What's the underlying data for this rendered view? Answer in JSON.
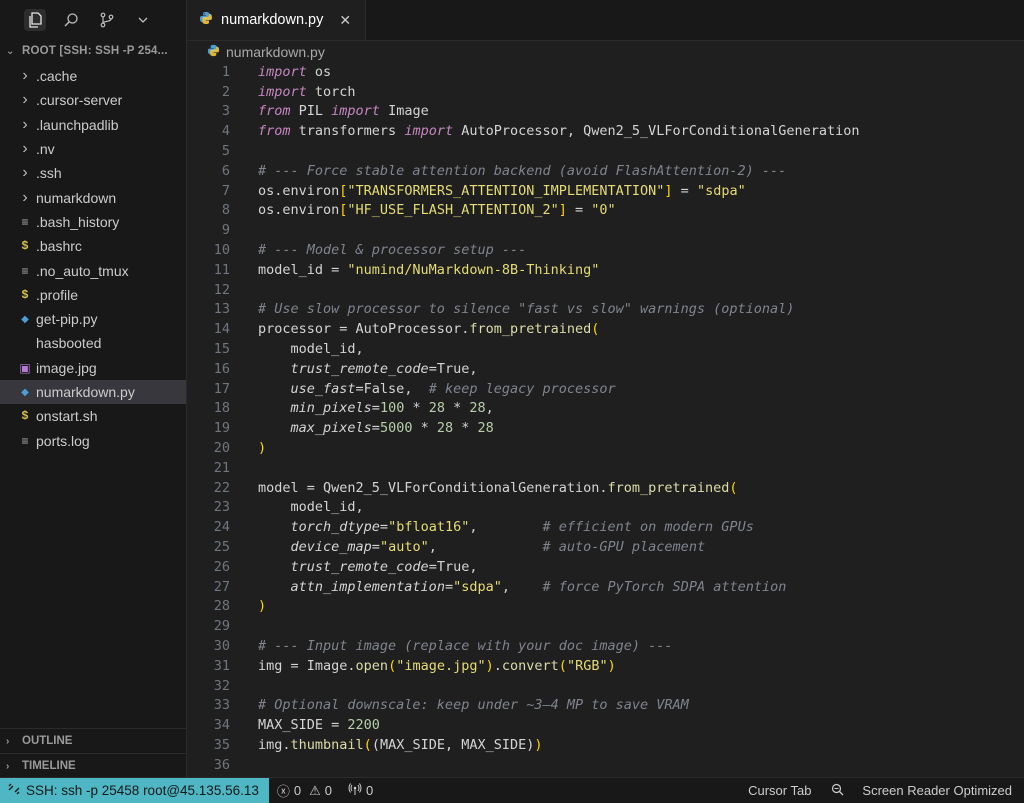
{
  "sidebar": {
    "root_label": "ROOT [SSH: SSH -P 254...",
    "items": [
      {
        "label": ".cache",
        "kind": "folder"
      },
      {
        "label": ".cursor-server",
        "kind": "folder"
      },
      {
        "label": ".launchpadlib",
        "kind": "folder"
      },
      {
        "label": ".nv",
        "kind": "folder"
      },
      {
        "label": ".ssh",
        "kind": "folder"
      },
      {
        "label": "numarkdown",
        "kind": "folder"
      },
      {
        "label": ".bash_history",
        "kind": "file"
      },
      {
        "label": ".bashrc",
        "kind": "shell"
      },
      {
        "label": ".no_auto_tmux",
        "kind": "file"
      },
      {
        "label": ".profile",
        "kind": "shell"
      },
      {
        "label": "get-pip.py",
        "kind": "python"
      },
      {
        "label": "hasbooted",
        "kind": "file-plain"
      },
      {
        "label": "image.jpg",
        "kind": "image"
      },
      {
        "label": "numarkdown.py",
        "kind": "python",
        "selected": true
      },
      {
        "label": "onstart.sh",
        "kind": "shell"
      },
      {
        "label": "ports.log",
        "kind": "file"
      }
    ],
    "outline_label": "OUTLINE",
    "timeline_label": "TIMELINE"
  },
  "editor": {
    "tab_label": "numarkdown.py",
    "close_glyph": "✕",
    "breadcrumb": "numarkdown.py",
    "lines": [
      [
        {
          "t": "k",
          "v": "import"
        },
        {
          "t": "txt",
          "v": " os"
        }
      ],
      [
        {
          "t": "k",
          "v": "import"
        },
        {
          "t": "txt",
          "v": " torch"
        }
      ],
      [
        {
          "t": "k",
          "v": "from"
        },
        {
          "t": "txt",
          "v": " PIL "
        },
        {
          "t": "k",
          "v": "import"
        },
        {
          "t": "txt",
          "v": " Image"
        }
      ],
      [
        {
          "t": "k",
          "v": "from"
        },
        {
          "t": "txt",
          "v": " transformers "
        },
        {
          "t": "k",
          "v": "import"
        },
        {
          "t": "txt",
          "v": " AutoProcessor, Qwen2_5_VLForConditionalGeneration"
        }
      ],
      [],
      [
        {
          "t": "c",
          "v": "# --- Force stable attention backend (avoid FlashAttention-2) ---"
        }
      ],
      [
        {
          "t": "txt",
          "v": "os.environ"
        },
        {
          "t": "p",
          "v": "["
        },
        {
          "t": "str",
          "v": "\"TRANSFORMERS_ATTENTION_IMPLEMENTATION\""
        },
        {
          "t": "p",
          "v": "]"
        },
        {
          "t": "txt",
          "v": " = "
        },
        {
          "t": "str",
          "v": "\"sdpa\""
        }
      ],
      [
        {
          "t": "txt",
          "v": "os.environ"
        },
        {
          "t": "p",
          "v": "["
        },
        {
          "t": "str",
          "v": "\"HF_USE_FLASH_ATTENTION_2\""
        },
        {
          "t": "p",
          "v": "]"
        },
        {
          "t": "txt",
          "v": " = "
        },
        {
          "t": "str",
          "v": "\"0\""
        }
      ],
      [],
      [
        {
          "t": "c",
          "v": "# --- Model & processor setup ---"
        }
      ],
      [
        {
          "t": "txt",
          "v": "model_id = "
        },
        {
          "t": "str",
          "v": "\"numind/NuMarkdown-8B-Thinking\""
        }
      ],
      [],
      [
        {
          "t": "c",
          "v": "# Use slow processor to silence \"fast vs slow\" warnings (optional)"
        }
      ],
      [
        {
          "t": "txt",
          "v": "processor = AutoProcessor."
        },
        {
          "t": "f",
          "v": "from_pretrained"
        },
        {
          "t": "p",
          "v": "("
        }
      ],
      [
        {
          "t": "txt",
          "v": "    model_id,"
        }
      ],
      [
        {
          "t": "txt",
          "v": "    "
        },
        {
          "t": "a",
          "v": "trust_remote_code"
        },
        {
          "t": "txt",
          "v": "=True,"
        }
      ],
      [
        {
          "t": "txt",
          "v": "    "
        },
        {
          "t": "a",
          "v": "use_fast"
        },
        {
          "t": "txt",
          "v": "=False,  "
        },
        {
          "t": "c",
          "v": "# keep legacy processor"
        }
      ],
      [
        {
          "t": "txt",
          "v": "    "
        },
        {
          "t": "a",
          "v": "min_pixels"
        },
        {
          "t": "txt",
          "v": "="
        },
        {
          "t": "n",
          "v": "100"
        },
        {
          "t": "txt",
          "v": " * "
        },
        {
          "t": "n",
          "v": "28"
        },
        {
          "t": "txt",
          "v": " * "
        },
        {
          "t": "n",
          "v": "28"
        },
        {
          "t": "txt",
          "v": ","
        }
      ],
      [
        {
          "t": "txt",
          "v": "    "
        },
        {
          "t": "a",
          "v": "max_pixels"
        },
        {
          "t": "txt",
          "v": "="
        },
        {
          "t": "n",
          "v": "5000"
        },
        {
          "t": "txt",
          "v": " * "
        },
        {
          "t": "n",
          "v": "28"
        },
        {
          "t": "txt",
          "v": " * "
        },
        {
          "t": "n",
          "v": "28"
        }
      ],
      [
        {
          "t": "p",
          "v": ")"
        }
      ],
      [],
      [
        {
          "t": "txt",
          "v": "model = Qwen2_5_VLForConditionalGeneration."
        },
        {
          "t": "f",
          "v": "from_pretrained"
        },
        {
          "t": "p",
          "v": "("
        }
      ],
      [
        {
          "t": "txt",
          "v": "    model_id,"
        }
      ],
      [
        {
          "t": "txt",
          "v": "    "
        },
        {
          "t": "a",
          "v": "torch_dtype"
        },
        {
          "t": "txt",
          "v": "="
        },
        {
          "t": "str",
          "v": "\"bfloat16\""
        },
        {
          "t": "txt",
          "v": ",        "
        },
        {
          "t": "c",
          "v": "# efficient on modern GPUs"
        }
      ],
      [
        {
          "t": "txt",
          "v": "    "
        },
        {
          "t": "a",
          "v": "device_map"
        },
        {
          "t": "txt",
          "v": "="
        },
        {
          "t": "str",
          "v": "\"auto\""
        },
        {
          "t": "txt",
          "v": ",             "
        },
        {
          "t": "c",
          "v": "# auto-GPU placement"
        }
      ],
      [
        {
          "t": "txt",
          "v": "    "
        },
        {
          "t": "a",
          "v": "trust_remote_code"
        },
        {
          "t": "txt",
          "v": "=True,"
        }
      ],
      [
        {
          "t": "txt",
          "v": "    "
        },
        {
          "t": "a",
          "v": "attn_implementation"
        },
        {
          "t": "txt",
          "v": "="
        },
        {
          "t": "str",
          "v": "\"sdpa\""
        },
        {
          "t": "txt",
          "v": ",    "
        },
        {
          "t": "c",
          "v": "# force PyTorch SDPA attention"
        }
      ],
      [
        {
          "t": "p",
          "v": ")"
        }
      ],
      [],
      [
        {
          "t": "c",
          "v": "# --- Input image (replace with your doc image) ---"
        }
      ],
      [
        {
          "t": "txt",
          "v": "img = Image."
        },
        {
          "t": "f",
          "v": "open"
        },
        {
          "t": "p",
          "v": "("
        },
        {
          "t": "str",
          "v": "\"image.jpg\""
        },
        {
          "t": "p",
          "v": ")"
        },
        {
          "t": "txt",
          "v": "."
        },
        {
          "t": "f",
          "v": "convert"
        },
        {
          "t": "p",
          "v": "("
        },
        {
          "t": "str",
          "v": "\"RGB\""
        },
        {
          "t": "p",
          "v": ")"
        }
      ],
      [],
      [
        {
          "t": "c",
          "v": "# Optional downscale: keep under ~3–4 MP to save VRAM"
        }
      ],
      [
        {
          "t": "txt",
          "v": "MAX_SIDE = "
        },
        {
          "t": "n",
          "v": "2200"
        }
      ],
      [
        {
          "t": "txt",
          "v": "img."
        },
        {
          "t": "f",
          "v": "thumbnail"
        },
        {
          "t": "p",
          "v": "("
        },
        {
          "t": "txt",
          "v": "(MAX_SIDE, MAX_SIDE)"
        },
        {
          "t": "p",
          "v": ")"
        }
      ],
      []
    ]
  },
  "statusbar": {
    "remote_label": "SSH: ssh -p 25458 root@45.135.56.13",
    "errors": "0",
    "warnings": "0",
    "ports": "0",
    "cursor_tab": "Cursor Tab",
    "screen_reader": "Screen Reader Optimized"
  }
}
